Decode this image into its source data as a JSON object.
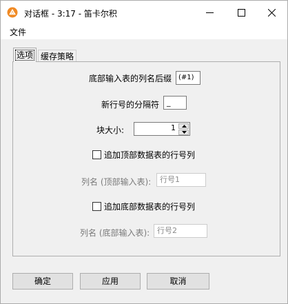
{
  "window": {
    "title": "对话框 - 3:17 - 笛卡尔积",
    "app_icon": "app-logo-icon",
    "controls": [
      "minimize-icon",
      "maximize-icon",
      "close-icon"
    ]
  },
  "menu": {
    "items": [
      "文件"
    ]
  },
  "tabs": [
    {
      "label": "选项",
      "active": true
    },
    {
      "label": "缓存策略",
      "active": false
    }
  ],
  "form": {
    "bottom_suffix_label": "底部输入表的列名后缀",
    "bottom_suffix_value": "(#1)",
    "separator_label": "新行号的分隔符",
    "separator_value": "_",
    "block_size_label": "块大小:",
    "block_size_value": "1",
    "add_top_rownum_label": "追加顶部数据表的行号列",
    "add_top_rownum_checked": false,
    "top_colname_label": "列名 (顶部输入表):",
    "top_colname_value": "行号1",
    "add_bottom_rownum_label": "追加底部数据表的行号列",
    "add_bottom_rownum_checked": false,
    "bottom_colname_label": "列名 (底部输入表):",
    "bottom_colname_value": "行号2"
  },
  "buttons": {
    "ok": "确定",
    "apply": "应用",
    "cancel": "取消"
  },
  "colors": {
    "window_bg": "#f0f0f0",
    "titlebar_bg": "#ffffff",
    "accent": "#f08a24"
  }
}
